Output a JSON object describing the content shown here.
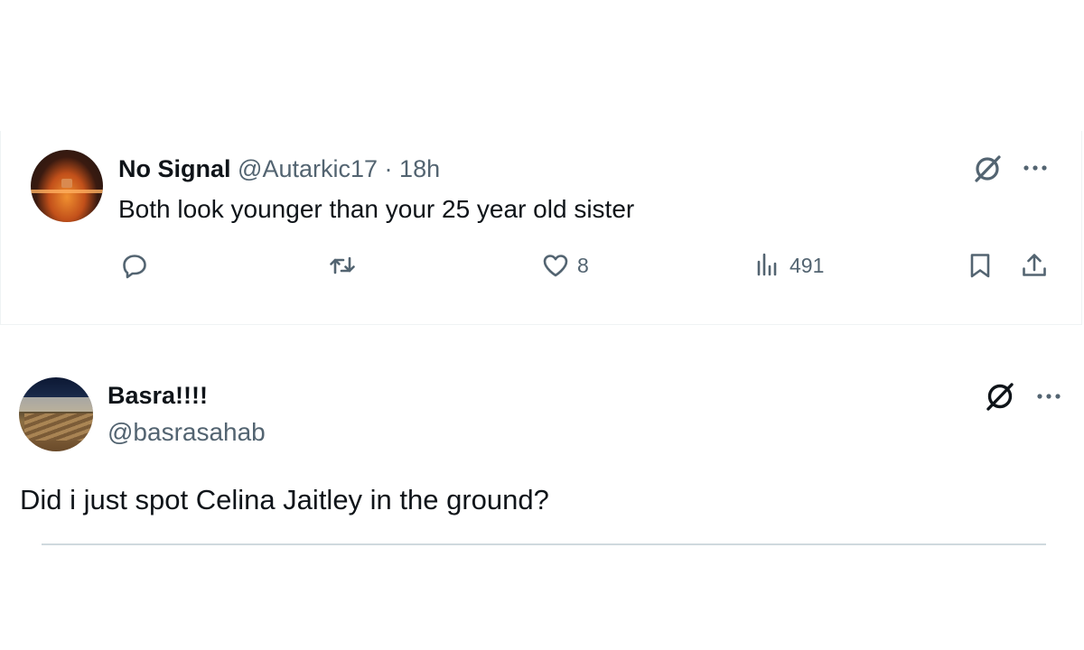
{
  "tweet1": {
    "name": "No Signal",
    "handle": "@Autarkic17",
    "separator": "·",
    "time": "18h",
    "text": "Both look younger than your 25 year old sister",
    "likes": "8",
    "views": "491",
    "icons": [
      "grok-icon",
      "more-icon",
      "reply-icon",
      "retweet-icon",
      "like-icon",
      "views-icon",
      "bookmark-icon",
      "share-icon"
    ]
  },
  "tweet2": {
    "name": "Basra!!!!",
    "handle": "@basrasahab",
    "text": "Did i just spot Celina Jaitley in the ground?",
    "icons": [
      "grok-icon",
      "more-icon"
    ]
  },
  "colors": {
    "text_primary": "#0f1419",
    "text_secondary": "#536471",
    "divider": "#cfd9de",
    "border": "#eff3f4"
  }
}
